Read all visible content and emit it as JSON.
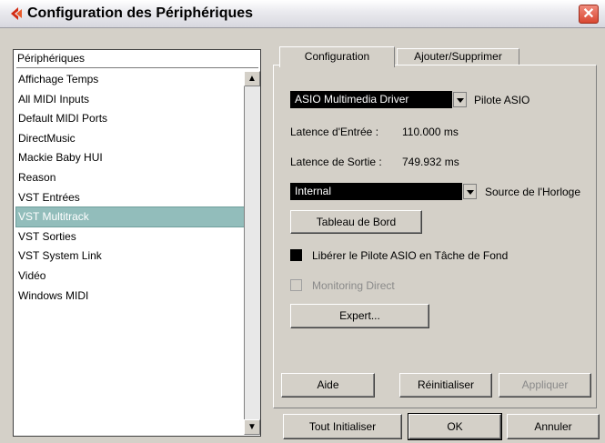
{
  "window": {
    "title": "Configuration des Périphériques",
    "close_glyph": "✕",
    "icon": "cubase-arrow-icon"
  },
  "devices": {
    "header": "Périphériques",
    "items": [
      {
        "label": "Affichage Temps",
        "selected": false
      },
      {
        "label": "All MIDI Inputs",
        "selected": false
      },
      {
        "label": "Default MIDI Ports",
        "selected": false
      },
      {
        "label": "DirectMusic",
        "selected": false
      },
      {
        "label": "Mackie Baby HUI",
        "selected": false
      },
      {
        "label": "Reason",
        "selected": false
      },
      {
        "label": "VST Entrées",
        "selected": false
      },
      {
        "label": "VST Multitrack",
        "selected": true
      },
      {
        "label": "VST Sorties",
        "selected": false
      },
      {
        "label": "VST System Link",
        "selected": false
      },
      {
        "label": "Vidéo",
        "selected": false
      },
      {
        "label": "Windows MIDI",
        "selected": false
      }
    ],
    "scroll_up": "▲",
    "scroll_down": "▼"
  },
  "tabs": [
    {
      "label": "Configuration",
      "active": true
    },
    {
      "label": "Ajouter/Supprimer",
      "active": false
    }
  ],
  "config": {
    "driver_value": "ASIO Multimedia Driver",
    "driver_label": "Pilote ASIO",
    "input_latency_label": "Latence d'Entrée :",
    "input_latency_value": "110.000 ms",
    "output_latency_label": "Latence de Sortie :",
    "output_latency_value": "749.932 ms",
    "clock_value": "Internal",
    "clock_label": "Source de l'Horloge",
    "control_panel_button": "Tableau de Bord",
    "release_driver_label": "Libérer le Pilote ASIO en Tâche de Fond",
    "release_driver_checked": true,
    "monitoring_label": "Monitoring Direct",
    "monitoring_enabled": false,
    "expert_button": "Expert..."
  },
  "panel_buttons": {
    "help": "Aide",
    "reset": "Réinitialiser",
    "apply": "Appliquer"
  },
  "footer_buttons": {
    "reset_all": "Tout Initialiser",
    "ok": "OK",
    "cancel": "Annuler"
  }
}
